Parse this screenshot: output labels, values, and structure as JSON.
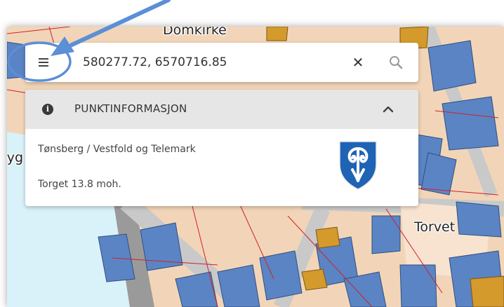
{
  "map": {
    "labels": {
      "domkirke": "Domkirke",
      "torvet": "Torvet",
      "partial_left": "ryg"
    },
    "colors": {
      "base": "#f2d5b8",
      "building_blue": "#5b84c4",
      "building_orange": "#d49a2c",
      "water": "#d9f1f9",
      "road": "#cfcfcf",
      "property_line": "#d0202a"
    }
  },
  "search": {
    "value": "580277.72, 6570716.85",
    "clear_symbol": "✕",
    "menu_icon": "hamburger-menu-icon",
    "search_icon": "magnifier-icon"
  },
  "info_panel": {
    "title": "PUNKTINFORMASJON",
    "info_icon_glyph": "i",
    "municipality": "Tønsberg / Vestfold og Telemark",
    "elevation": "Torget 13.8 moh.",
    "crest_colors": {
      "field": "#1f63b4",
      "figure": "#ffffff"
    }
  },
  "annotation": {
    "color": "#5b8fd6"
  }
}
